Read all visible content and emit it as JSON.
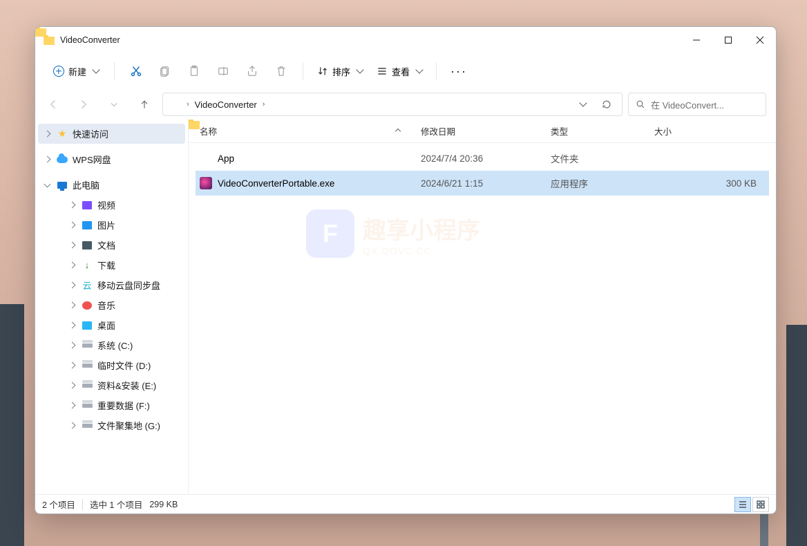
{
  "title": "VideoConverter",
  "toolbar": {
    "new": "新建",
    "sort": "排序",
    "view": "查看"
  },
  "breadcrumb": {
    "folder": "VideoConverter"
  },
  "search": {
    "placeholder": "在 VideoConvert..."
  },
  "sidebar": {
    "quick": "快速访问",
    "wps": "WPS网盘",
    "pc": "此电脑",
    "video": "视频",
    "pictures": "图片",
    "docs": "文档",
    "downloads": "下载",
    "clouddisk": "移动云盘同步盘",
    "music": "音乐",
    "desktop": "桌面",
    "sysC": "系统 (C:)",
    "tempD": "临时文件 (D:)",
    "dataE": "资料&安装 (E:)",
    "impF": "重要数据 (F:)",
    "collG": "文件聚集地 (G:)"
  },
  "columns": {
    "name": "名称",
    "date": "修改日期",
    "type": "类型",
    "size": "大小"
  },
  "rows": [
    {
      "name": "App",
      "date": "2024/7/4 20:36",
      "type": "文件夹",
      "size": "",
      "kind": "folder"
    },
    {
      "name": "VideoConverterPortable.exe",
      "date": "2024/6/21 1:15",
      "type": "应用程序",
      "size": "300 KB",
      "kind": "exe"
    }
  ],
  "status": {
    "count": "2 个项目",
    "selection": "选中 1 个项目",
    "size": "299 KB"
  },
  "watermark": {
    "text": "趣享小程序",
    "sub": "QX.OOVC.CC"
  }
}
